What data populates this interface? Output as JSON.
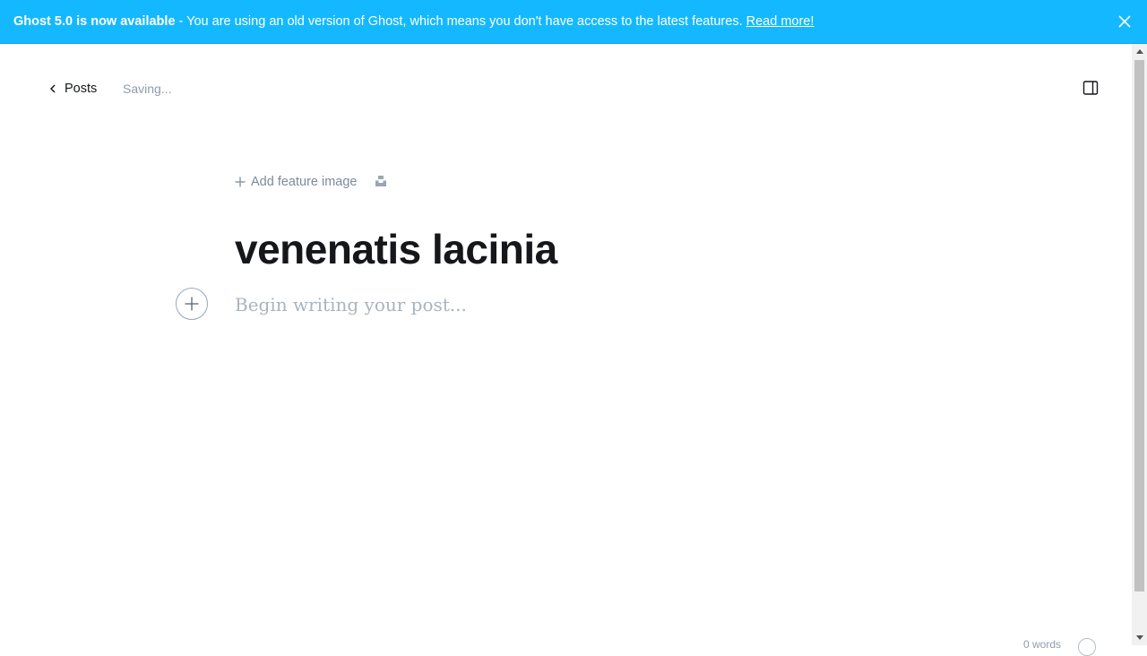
{
  "banner": {
    "headline": "Ghost 5.0 is now available",
    "message": " - You are using an old version of Ghost, which means you don't have access to the latest features. ",
    "link_label": "Read more!",
    "background_color": "#14b8ff",
    "close_icon": "close-icon"
  },
  "editor_header": {
    "back_label": "Posts",
    "back_icon": "chevron-left-icon",
    "save_status": "Saving...",
    "settings_icon": "sidebar-toggle-icon"
  },
  "feature_image": {
    "add_label": "Add feature image",
    "add_icon": "plus-icon",
    "unsplash_icon": "unsplash-icon"
  },
  "post": {
    "title": "venenatis lacinia",
    "body_placeholder": "Begin writing your post...",
    "add_card_icon": "plus-icon"
  },
  "footer": {
    "word_count": "0 words",
    "help_icon": "help-icon"
  }
}
